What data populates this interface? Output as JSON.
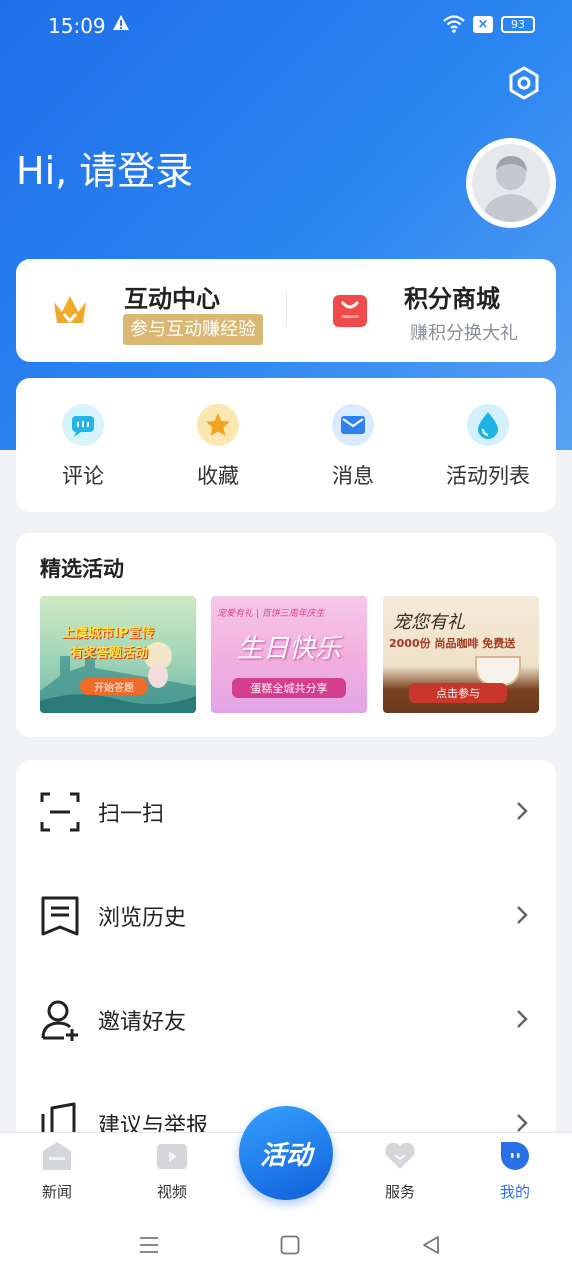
{
  "status_bar": {
    "time": "15:09",
    "battery": "93"
  },
  "header": {
    "greeting": "Hi, 请登录"
  },
  "top_cards": {
    "interaction": {
      "title": "互动中心",
      "badge": "参与互动赚经验"
    },
    "mall": {
      "title": "积分商城",
      "subtitle": "赚积分换大礼"
    }
  },
  "quick_actions": [
    {
      "label": "评论",
      "icon": "comment-icon"
    },
    {
      "label": "收藏",
      "icon": "star-icon"
    },
    {
      "label": "消息",
      "icon": "mail-icon"
    },
    {
      "label": "活动列表",
      "icon": "drop-icon"
    }
  ],
  "featured": {
    "title": "精选活动",
    "banners": [
      {
        "headline": "上虞城市IP宣传",
        "sub": "有奖答题活动",
        "button": "开始答题"
      },
      {
        "headline": "宠爱有礼 | 百饼三周年庆生",
        "sub": "生日快乐",
        "button": "蛋糕全城共分享"
      },
      {
        "headline": "宠您有礼",
        "sub": "2000份 尚品咖啡 免费送",
        "button": "点击参与"
      }
    ]
  },
  "menu": [
    {
      "label": "扫一扫",
      "icon": "scan-icon"
    },
    {
      "label": "浏览历史",
      "icon": "history-icon"
    },
    {
      "label": "邀请好友",
      "icon": "invite-friend-icon"
    },
    {
      "label": "建议与举报",
      "icon": "feedback-icon"
    }
  ],
  "tabbar": {
    "items": [
      {
        "label": "新闻",
        "icon": "news-icon"
      },
      {
        "label": "视频",
        "icon": "video-icon"
      },
      {
        "label": "服务",
        "icon": "heart-icon"
      },
      {
        "label": "我的",
        "icon": "profile-icon",
        "active": true
      }
    ],
    "center_label": "活动",
    "active_color": "#2a6fe6"
  },
  "colors": {
    "brand_blue": "#2378ee",
    "gold_badge": "#d9b873"
  }
}
